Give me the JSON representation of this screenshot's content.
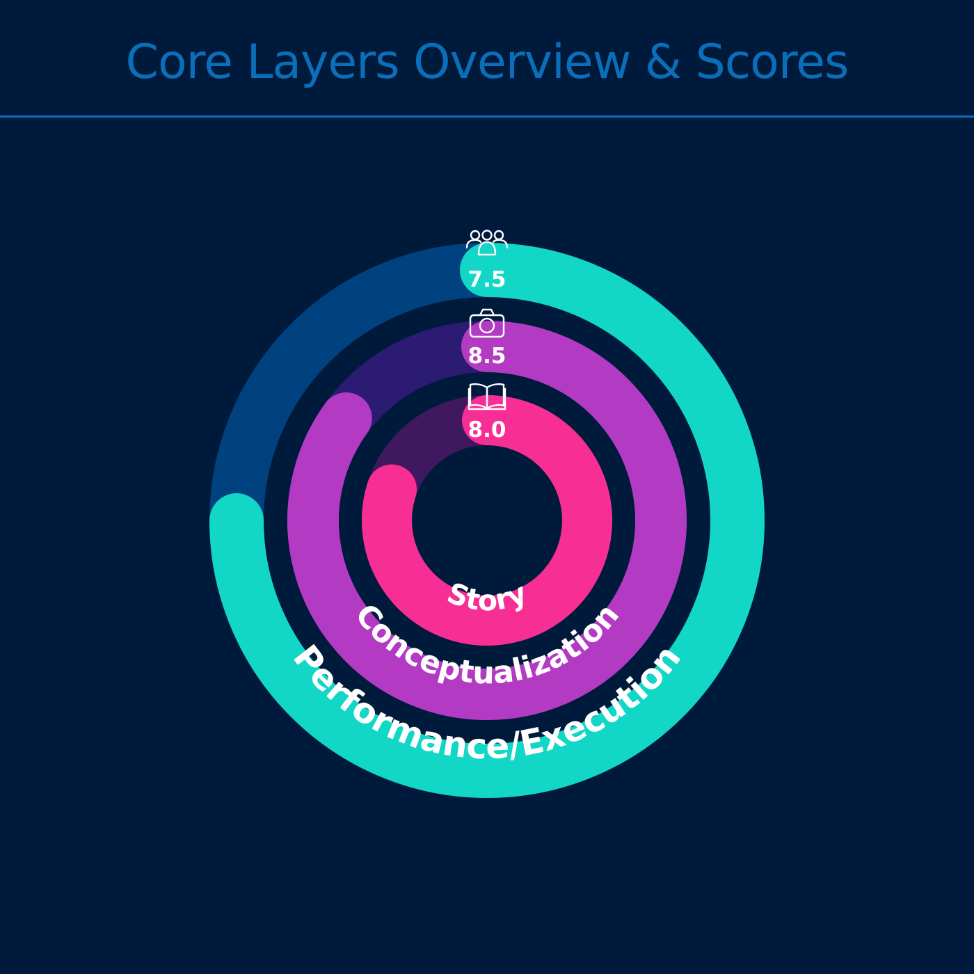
{
  "colors": {
    "background": "#001a3b",
    "title": "#0a6fb8",
    "rule": "#0a6fb8"
  },
  "chart_data": {
    "type": "radial_bar",
    "title": "Core Layers Overview & Scores",
    "max_score": 10,
    "series": [
      {
        "name": "Performance/Execution",
        "value": 7.5,
        "display_value": "7.5",
        "icon": "people-group-icon",
        "color": "#12d6c6",
        "track_color": "#00427f"
      },
      {
        "name": "Conceptualization",
        "value": 8.5,
        "display_value": "8.5",
        "icon": "camera-icon",
        "color": "#b33bc4",
        "track_color": "#2b1b72"
      },
      {
        "name": "Story",
        "value": 8.0,
        "display_value": "8.0",
        "icon": "open-book-icon",
        "color": "#f72f94",
        "track_color": "#3f1860"
      }
    ]
  }
}
